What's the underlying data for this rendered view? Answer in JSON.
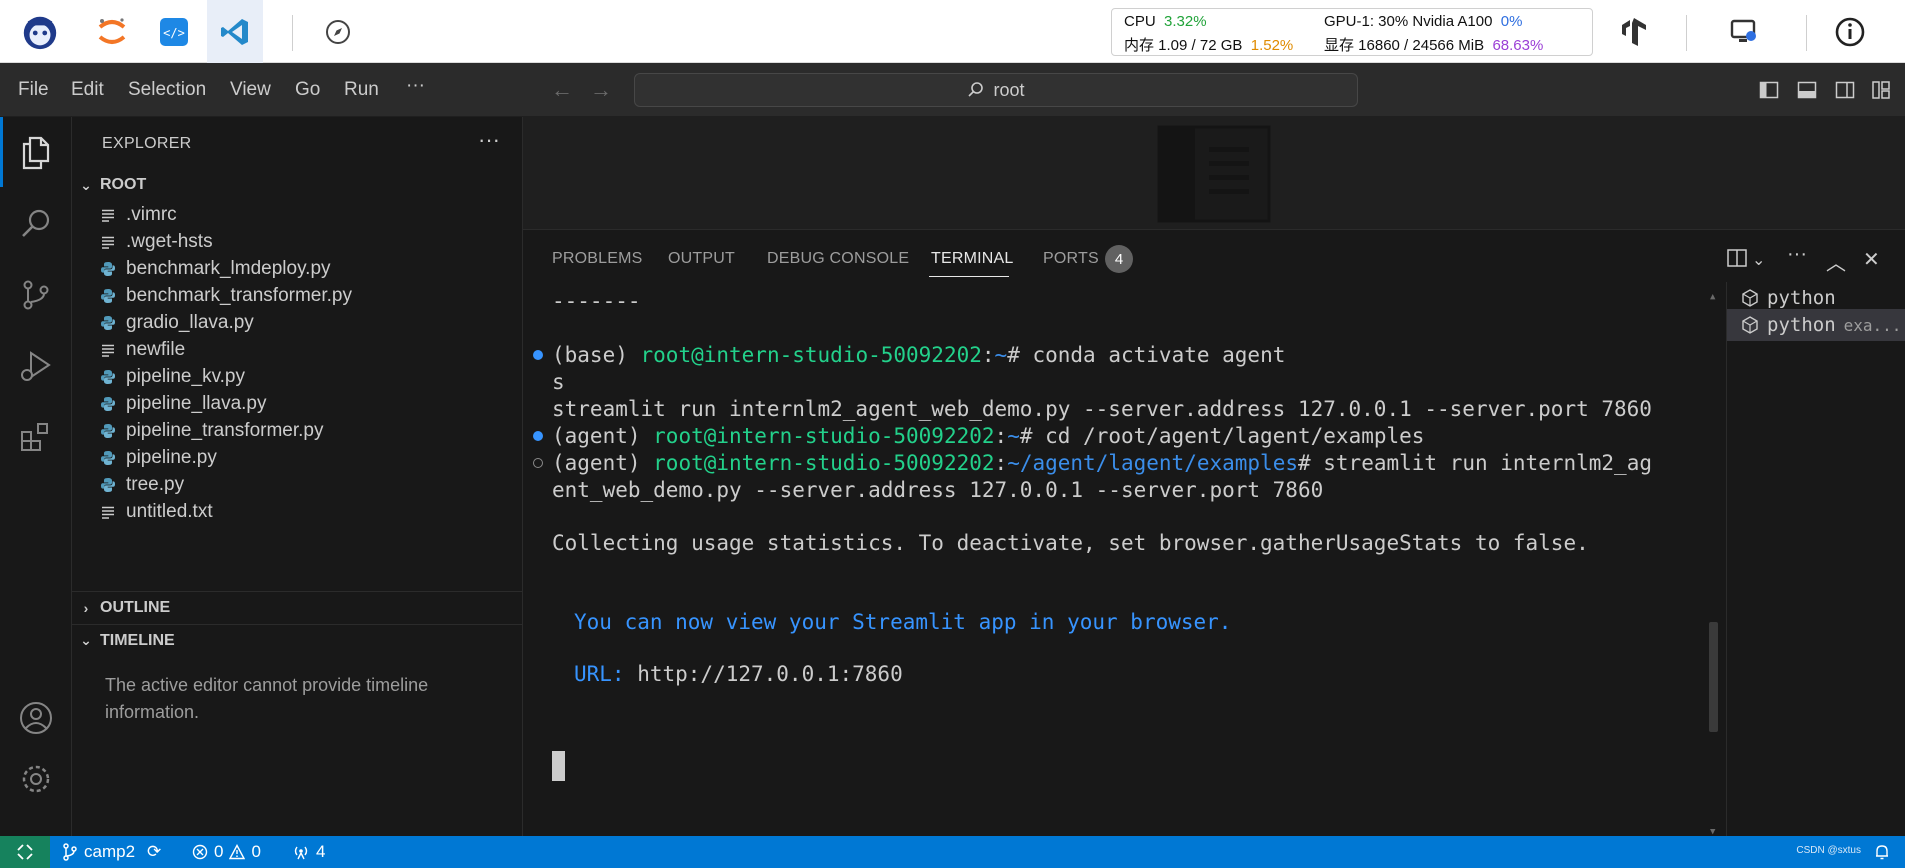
{
  "topbar": {
    "apps": [
      "lab-logo-icon",
      "jupyter-icon",
      "code-editor-icon",
      "vscode-icon",
      "compass-icon"
    ],
    "stats": {
      "cpu_label": "CPU",
      "cpu_value": "3.32%",
      "mem_label": "内存 1.09 / 72 GB",
      "mem_value": "1.52%",
      "gpu_label": "GPU-1: 30% Nvidia A100",
      "gpu_value": "0%",
      "vram_label": "显存 16860 / 24566 MiB",
      "vram_value": "68.63%"
    }
  },
  "menubar": {
    "items": [
      "File",
      "Edit",
      "Selection",
      "View",
      "Go",
      "Run",
      "···"
    ],
    "search_text": "root"
  },
  "sidebar": {
    "title": "EXPLORER",
    "more": "···",
    "root_label": "ROOT",
    "files": [
      {
        "name": ".vimrc",
        "type": "text"
      },
      {
        "name": ".wget-hsts",
        "type": "text"
      },
      {
        "name": "benchmark_lmdeploy.py",
        "type": "python"
      },
      {
        "name": "benchmark_transformer.py",
        "type": "python"
      },
      {
        "name": "gradio_llava.py",
        "type": "python"
      },
      {
        "name": "newfile",
        "type": "text"
      },
      {
        "name": "pipeline_kv.py",
        "type": "python"
      },
      {
        "name": "pipeline_llava.py",
        "type": "python"
      },
      {
        "name": "pipeline_transformer.py",
        "type": "python"
      },
      {
        "name": "pipeline.py",
        "type": "python"
      },
      {
        "name": "tree.py",
        "type": "python"
      },
      {
        "name": "untitled.txt",
        "type": "text"
      }
    ],
    "outline_label": "OUTLINE",
    "timeline_label": "TIMELINE",
    "timeline_text": "The active editor cannot provide timeline information."
  },
  "panel": {
    "tabs": [
      "PROBLEMS",
      "OUTPUT",
      "DEBUG CONSOLE",
      "TERMINAL",
      "PORTS"
    ],
    "active_tab": "TERMINAL",
    "ports_count": "4",
    "terminal": {
      "lines": {
        "l0": "-------",
        "l1_prefix": "(base) ",
        "l1_user": "root@intern-studio-50092202",
        "l1_colon": ":",
        "l1_path": "~",
        "l1_cmd": "# conda activate agent",
        "l2": "s",
        "l3": "streamlit run internlm2_agent_web_demo.py --server.address 127.0.0.1 --server.port 7860",
        "l4_prefix": "(agent) ",
        "l4_user": "root@intern-studio-50092202",
        "l4_colon": ":",
        "l4_path": "~",
        "l4_cmd": "# cd /root/agent/lagent/examples",
        "l5_prefix": "(agent) ",
        "l5_user": "root@intern-studio-50092202",
        "l5_colon": ":",
        "l5_path": "~/agent/lagent/examples",
        "l5_cmd": "# streamlit run internlm2_ag",
        "l6": "ent_web_demo.py --server.address 127.0.0.1 --server.port 7860",
        "l7": "Collecting usage statistics. To deactivate, set browser.gatherUsageStats to false.",
        "l8": "You can now view your Streamlit app in your browser.",
        "l9_label": "URL: ",
        "l9_url": "http://127.0.0.1:7860"
      }
    },
    "terminal_list": [
      {
        "name": "python",
        "sub": ""
      },
      {
        "name": "python",
        "sub": "exa..."
      }
    ]
  },
  "statusbar": {
    "branch": "camp2",
    "errors": "0",
    "warnings": "0",
    "ports": "4",
    "watermark": "CSDN @sxtus"
  }
}
